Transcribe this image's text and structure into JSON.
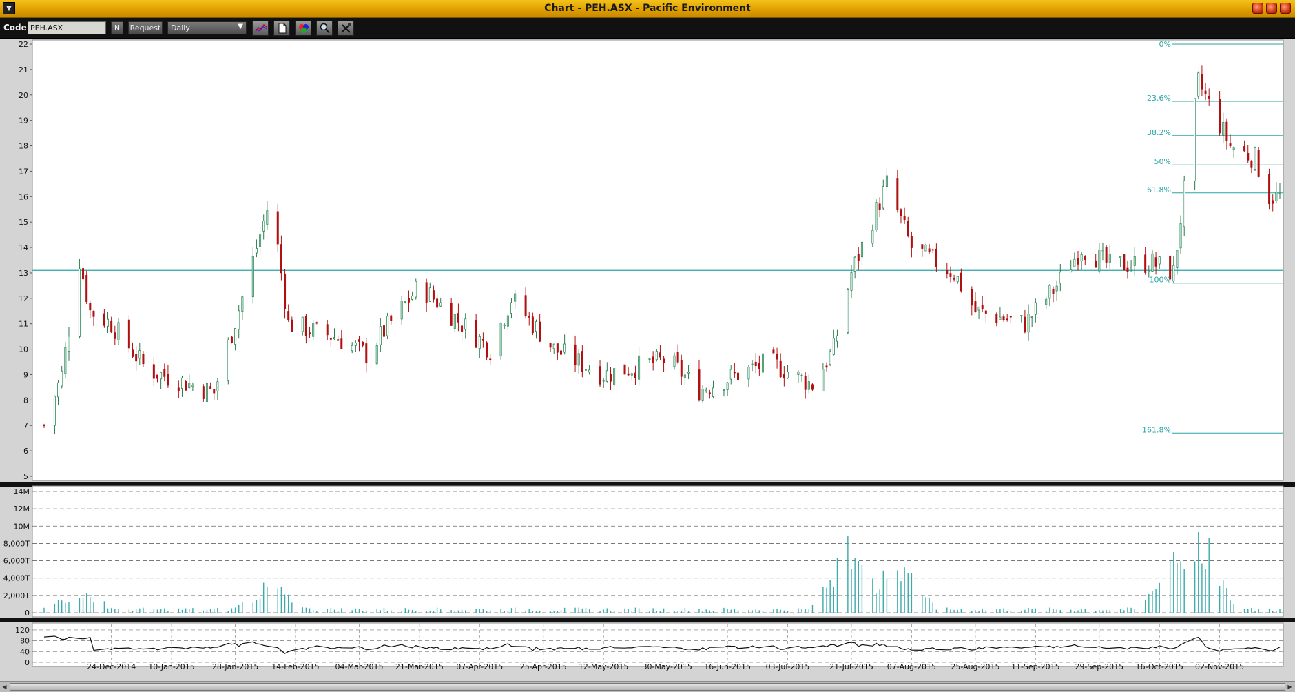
{
  "window": {
    "title": "Chart - PEH.ASX - Pacific Environment"
  },
  "toolbar": {
    "code_label": "Code:",
    "code_value": "PEH.ASX",
    "n_button": "N",
    "request_button": "Request",
    "period_select": "Daily",
    "icons": [
      "indicator-icon",
      "page-icon",
      "color-palette-icon",
      "zoom-icon",
      "tools-icon"
    ]
  },
  "colors": {
    "up_candle": "#5ec48a",
    "down_candle": "#b01010",
    "fib_line": "#2aa6a6",
    "volume_bar": "#3aaaaa",
    "panel_bg": "#ffffff",
    "title_bar": "#e8aa00"
  },
  "price_panel": {
    "y_ticks": [
      "22",
      "21",
      "20",
      "19",
      "18",
      "17",
      "16",
      "15",
      "14",
      "13",
      "12",
      "11",
      "10",
      "9",
      "8",
      "7",
      "6",
      "5"
    ],
    "ylim": [
      5,
      22
    ],
    "horizontal_line": 13.1,
    "fib_levels": [
      {
        "label": "0%",
        "value": 22.0
      },
      {
        "label": "23.6%",
        "value": 19.75
      },
      {
        "label": "38.2%",
        "value": 18.4
      },
      {
        "label": "50%",
        "value": 17.25
      },
      {
        "label": "61.8%",
        "value": 16.15
      },
      {
        "label": "100%",
        "value": 12.6
      },
      {
        "label": "161.8%",
        "value": 6.7
      }
    ]
  },
  "volume_panel": {
    "y_ticks": [
      "14M",
      "12M",
      "10M",
      "8,000T",
      "6,000T",
      "4,000T",
      "2,000T",
      "0"
    ],
    "ylim": [
      0,
      14000000
    ]
  },
  "oscillator_panel": {
    "y_ticks": [
      "120",
      "80",
      "40",
      "0"
    ],
    "ylim": [
      0,
      130
    ]
  },
  "x_axis": {
    "date_labels": [
      "24-Dec-2014",
      "10-Jan-2015",
      "28-Jan-2015",
      "14-Feb-2015",
      "04-Mar-2015",
      "21-Mar-2015",
      "07-Apr-2015",
      "25-Apr-2015",
      "12-May-2015",
      "30-May-2015",
      "16-Jun-2015",
      "03-Jul-2015",
      "21-Jul-2015",
      "07-Aug-2015",
      "25-Aug-2015",
      "11-Sep-2015",
      "29-Sep-2015",
      "16-Oct-2015",
      "02-Nov-2015"
    ]
  },
  "chart_data": {
    "type": "candlestick",
    "title": "PEH.ASX - Pacific Environment",
    "x_start": "2014-12-05",
    "price_range": [
      5,
      22
    ],
    "anchors": [
      {
        "date": "2014-12-05",
        "close": 7.0
      },
      {
        "date": "2014-12-10",
        "close": 9.0
      },
      {
        "date": "2014-12-15",
        "close": 13.5
      },
      {
        "date": "2014-12-18",
        "close": 11.5
      },
      {
        "date": "2014-12-24",
        "close": 11.0
      },
      {
        "date": "2015-01-03",
        "close": 9.2
      },
      {
        "date": "2015-01-22",
        "close": 8.3
      },
      {
        "date": "2015-01-31",
        "close": 12.5
      },
      {
        "date": "2015-02-07",
        "close": 16.0
      },
      {
        "date": "2015-02-12",
        "close": 11.0
      },
      {
        "date": "2015-02-25",
        "close": 10.5
      },
      {
        "date": "2015-03-06",
        "close": 9.8
      },
      {
        "date": "2015-03-21",
        "close": 12.5
      },
      {
        "date": "2015-04-02",
        "close": 11.0
      },
      {
        "date": "2015-04-10",
        "close": 10.0
      },
      {
        "date": "2015-04-16",
        "close": 12.0
      },
      {
        "date": "2015-04-28",
        "close": 10.0
      },
      {
        "date": "2015-05-12",
        "close": 9.0
      },
      {
        "date": "2015-05-30",
        "close": 9.6
      },
      {
        "date": "2015-06-08",
        "close": 8.4
      },
      {
        "date": "2015-06-28",
        "close": 9.5
      },
      {
        "date": "2015-07-10",
        "close": 8.6
      },
      {
        "date": "2015-07-16",
        "close": 10.0
      },
      {
        "date": "2015-07-21",
        "close": 13.0
      },
      {
        "date": "2015-07-31",
        "close": 16.5
      },
      {
        "date": "2015-08-07",
        "close": 14.0
      },
      {
        "date": "2015-08-19",
        "close": 13.0
      },
      {
        "date": "2015-08-25",
        "close": 11.5
      },
      {
        "date": "2015-09-08",
        "close": 11.0
      },
      {
        "date": "2015-09-17",
        "close": 12.5
      },
      {
        "date": "2015-09-24",
        "close": 14.0
      },
      {
        "date": "2015-10-02",
        "close": 13.3
      },
      {
        "date": "2015-10-14",
        "close": 13.4
      },
      {
        "date": "2015-10-20",
        "close": 13.0
      },
      {
        "date": "2015-10-27",
        "close": 20.5
      },
      {
        "date": "2015-11-05",
        "close": 18.0
      },
      {
        "date": "2015-11-12",
        "close": 17.5
      },
      {
        "date": "2015-11-16",
        "close": 16.0
      }
    ],
    "volume_spikes": [
      {
        "date": "2014-12-15",
        "value": 3000000
      },
      {
        "date": "2015-02-07",
        "value": 3800000
      },
      {
        "date": "2015-07-21",
        "value": 9800000
      },
      {
        "date": "2015-08-03",
        "value": 7000000
      },
      {
        "date": "2015-10-27",
        "value": 10500000
      },
      {
        "date": "2015-10-20",
        "value": 6500000
      }
    ],
    "oscillator_baseline": 55
  }
}
